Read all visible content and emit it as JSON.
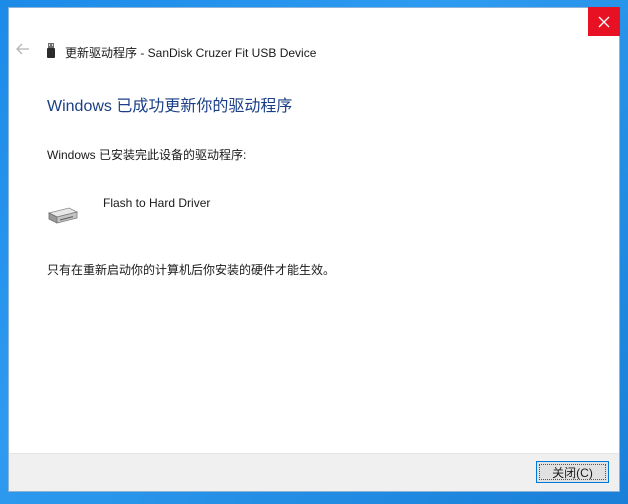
{
  "window": {
    "title": "更新驱动程序 - SanDisk Cruzer Fit USB Device"
  },
  "content": {
    "heading": "Windows 已成功更新你的驱动程序",
    "installed_label": "Windows 已安装完此设备的驱动程序:",
    "device_name": "Flash to Hard Driver",
    "restart_notice": "只有在重新启动你的计算机后你安装的硬件才能生效。"
  },
  "footer": {
    "close_label": "关闭(C)"
  },
  "colors": {
    "desktop": "#1c8be8",
    "close_x_background": "#e81123",
    "heading": "#1a3f86",
    "button_border": "#0078d7"
  },
  "icons": {
    "back": "back-arrow-icon",
    "usb": "usb-drive-icon",
    "device": "hard-drive-icon",
    "close": "close-icon"
  }
}
